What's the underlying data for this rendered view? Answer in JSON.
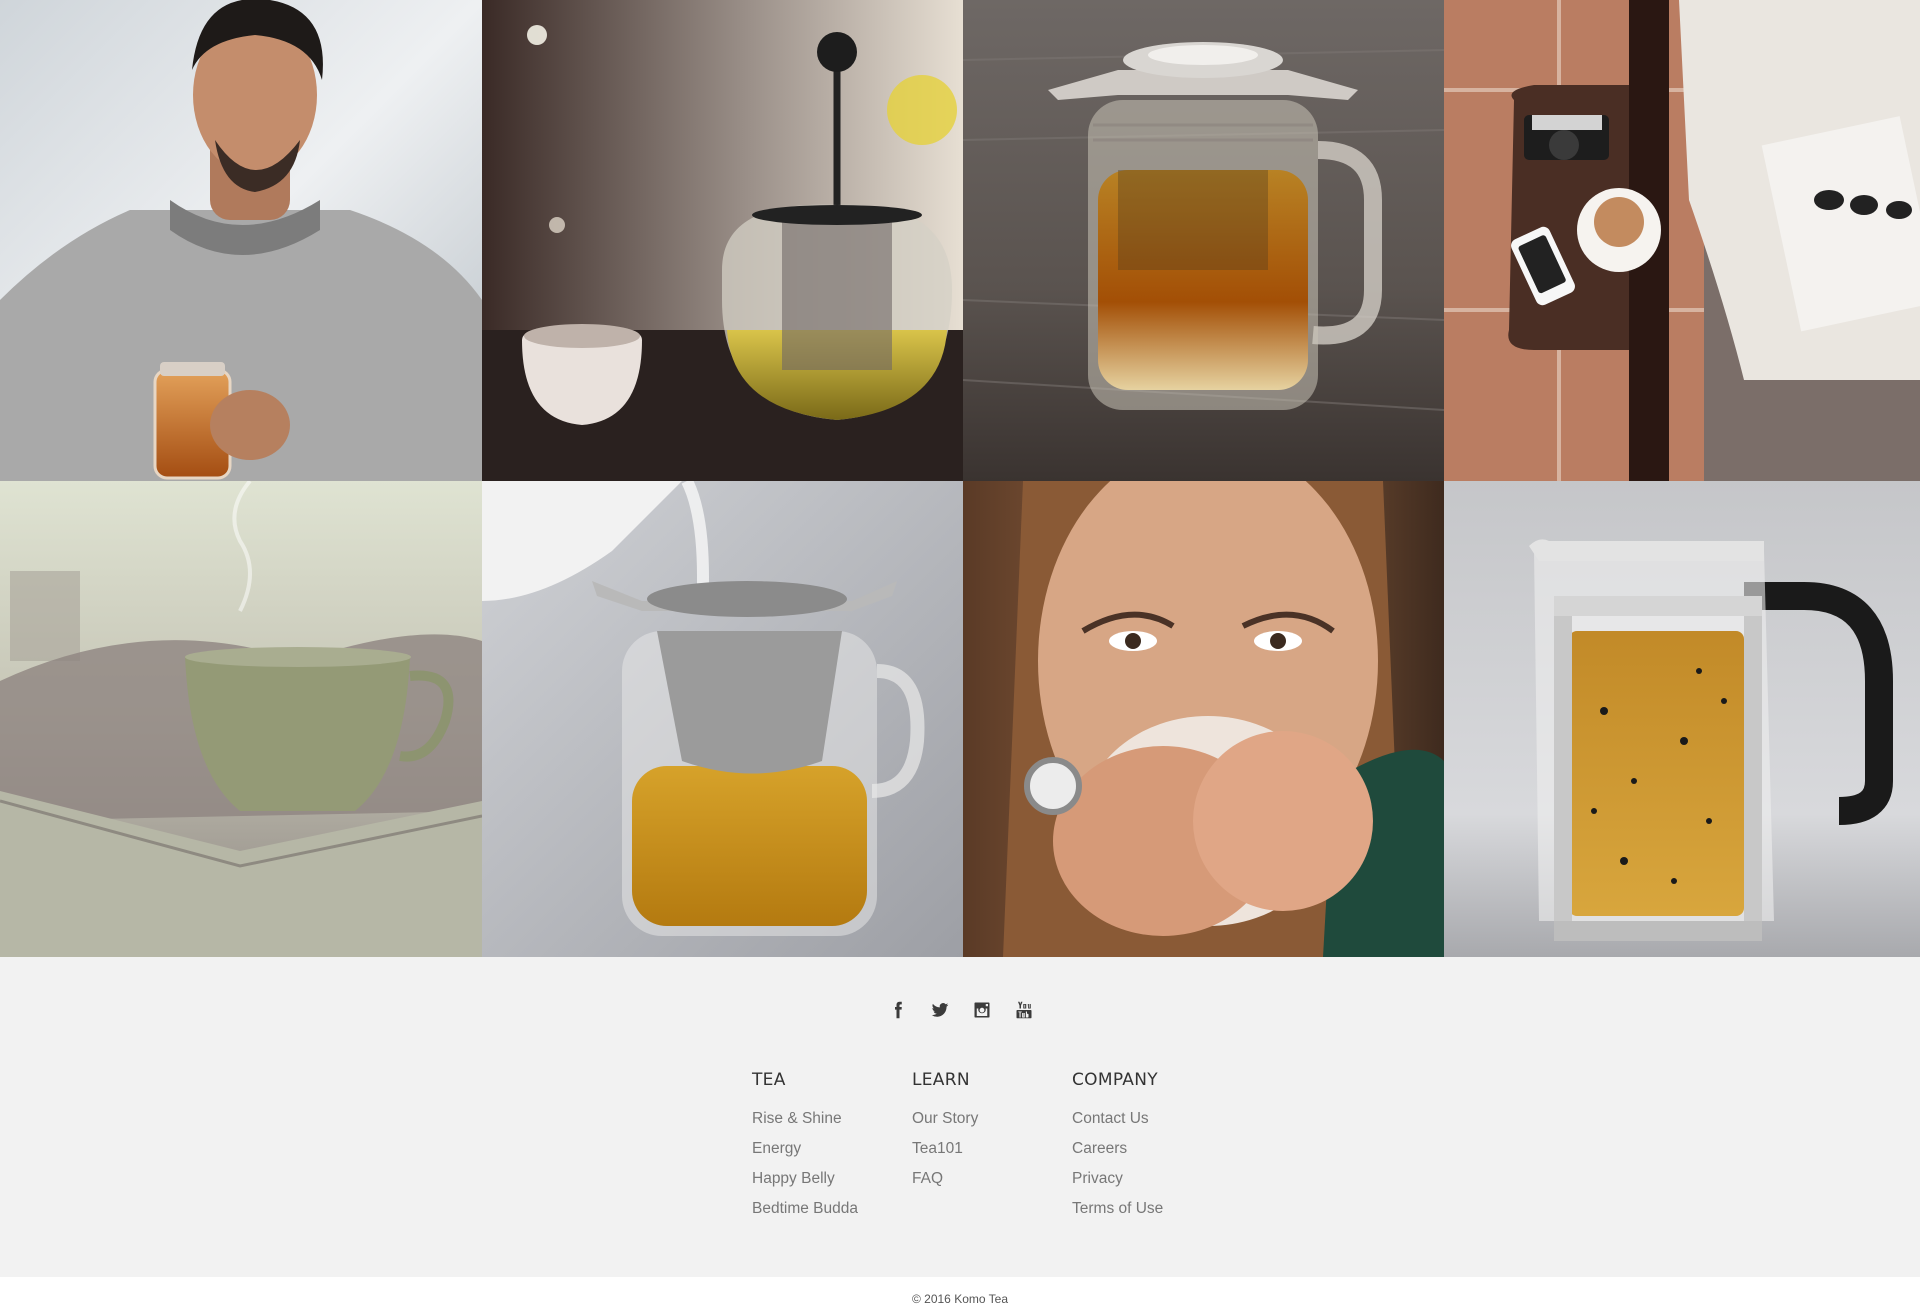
{
  "gallery": {
    "tiles": [
      {
        "subject": "man-holding-tea-jar"
      },
      {
        "subject": "teapot-with-cup"
      },
      {
        "subject": "tea-jar-with-infuser"
      },
      {
        "subject": "tea-on-wooden-stool"
      },
      {
        "subject": "steaming-mug-on-book"
      },
      {
        "subject": "pouring-water-into-jar"
      },
      {
        "subject": "woman-drinking-tea"
      },
      {
        "subject": "french-press-with-tea"
      }
    ]
  },
  "social": {
    "icons": [
      "facebook-icon",
      "twitter-icon",
      "instagram-icon",
      "youtube-icon"
    ]
  },
  "footer": {
    "columns": [
      {
        "heading": "TEA",
        "links": [
          "Rise & Shine",
          "Energy",
          "Happy Belly",
          "Bedtime Budda"
        ]
      },
      {
        "heading": "LEARN",
        "links": [
          "Our Story",
          "Tea101",
          "FAQ"
        ]
      },
      {
        "heading": "COMPANY",
        "links": [
          "Contact Us",
          "Careers",
          "Privacy",
          "Terms of Use"
        ]
      }
    ],
    "copyright": "© 2016 Komo Tea"
  }
}
